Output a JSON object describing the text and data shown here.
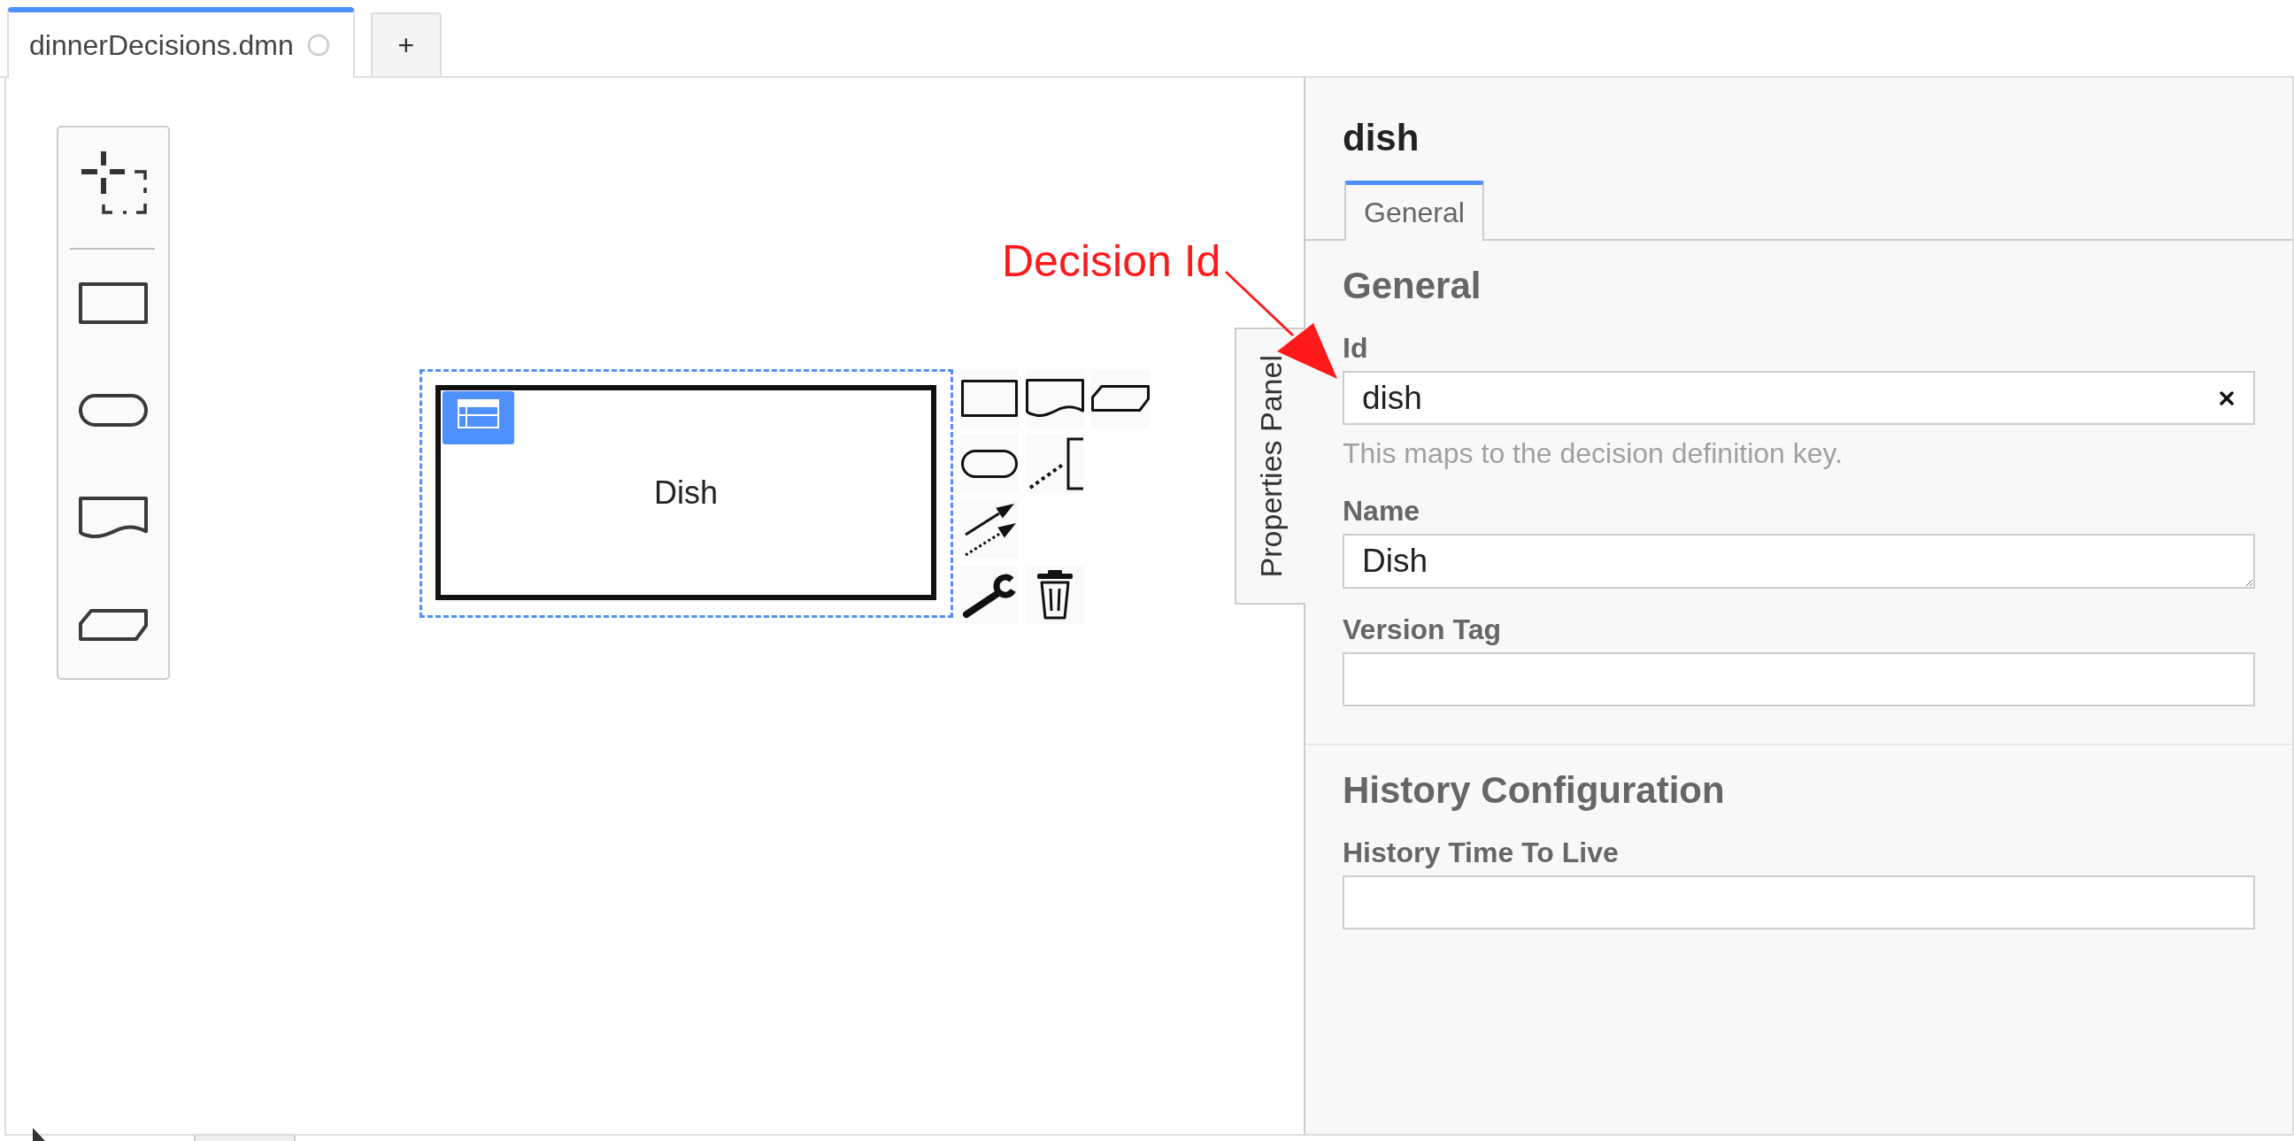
{
  "tabs": [
    {
      "label": "dinnerDecisions.dmn",
      "selected": true
    }
  ],
  "add_tab": {
    "label": "+"
  },
  "palette": {
    "tools": [
      {
        "kind": "lasso"
      }
    ],
    "shapes": [
      {
        "kind": "rectangle"
      },
      {
        "kind": "rounded"
      },
      {
        "kind": "document"
      },
      {
        "kind": "cut_corner"
      }
    ]
  },
  "canvas": {
    "nodes": [
      {
        "kind": "decision_table",
        "label": "Dish",
        "selected": true
      }
    ]
  },
  "context_pad": {
    "groups": [
      {
        "entries": [
          {
            "kind": "rectangle"
          },
          {
            "kind": "document"
          },
          {
            "kind": "cut_corner"
          }
        ]
      },
      {
        "entries": [
          {
            "kind": "rounded"
          },
          {
            "kind": "association"
          }
        ]
      },
      {
        "entries": [
          {
            "kind": "connect"
          }
        ]
      },
      {
        "entries": [
          {
            "kind": "wrench"
          },
          {
            "kind": "delete"
          }
        ]
      }
    ]
  },
  "annotation": {
    "text": "Decision Id"
  },
  "properties_panel": {
    "toggle_label": "Properties Panel",
    "title": "dish",
    "tabs": [
      {
        "label": "General",
        "selected": true
      }
    ],
    "groups": [
      {
        "title": "General",
        "fields": [
          {
            "kind": "input",
            "label": "Id",
            "value": "dish",
            "clearable": true,
            "description": "This maps to the decision definition key."
          },
          {
            "kind": "textarea",
            "label": "Name",
            "value": "Dish"
          },
          {
            "kind": "input",
            "label": "Version Tag"
          }
        ]
      },
      {
        "title": "History Configuration",
        "fields": [
          {
            "kind": "input",
            "label": "History Time To Live"
          }
        ]
      }
    ]
  }
}
